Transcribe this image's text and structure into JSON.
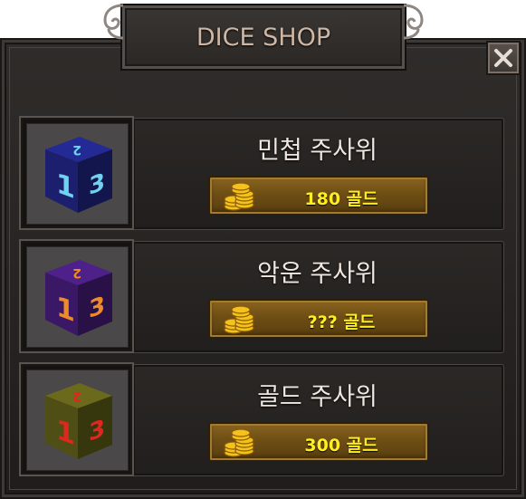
{
  "window": {
    "title": "DICE SHOP"
  },
  "items": [
    {
      "name": "민첩 주사위",
      "price": "180 골드",
      "die_color": "#1b1f6e",
      "numeral_color": "#6fd3f0",
      "icon": "blue-die-icon"
    },
    {
      "name": "악운 주사위",
      "price": "??? 골드",
      "die_color": "#3a1866",
      "numeral_color": "#ef8a28",
      "icon": "purple-die-icon"
    },
    {
      "name": "골드 주사위",
      "price": "300 골드",
      "die_color": "#4f4e14",
      "numeral_color": "#e0261e",
      "icon": "gold-die-icon"
    }
  ],
  "colors": {
    "price_text": "#ffee22",
    "title_text": "#cdb6a4",
    "price_button": "#7a5718"
  },
  "icons": {
    "close": "close-icon",
    "coins": "coin-stack-icon"
  }
}
